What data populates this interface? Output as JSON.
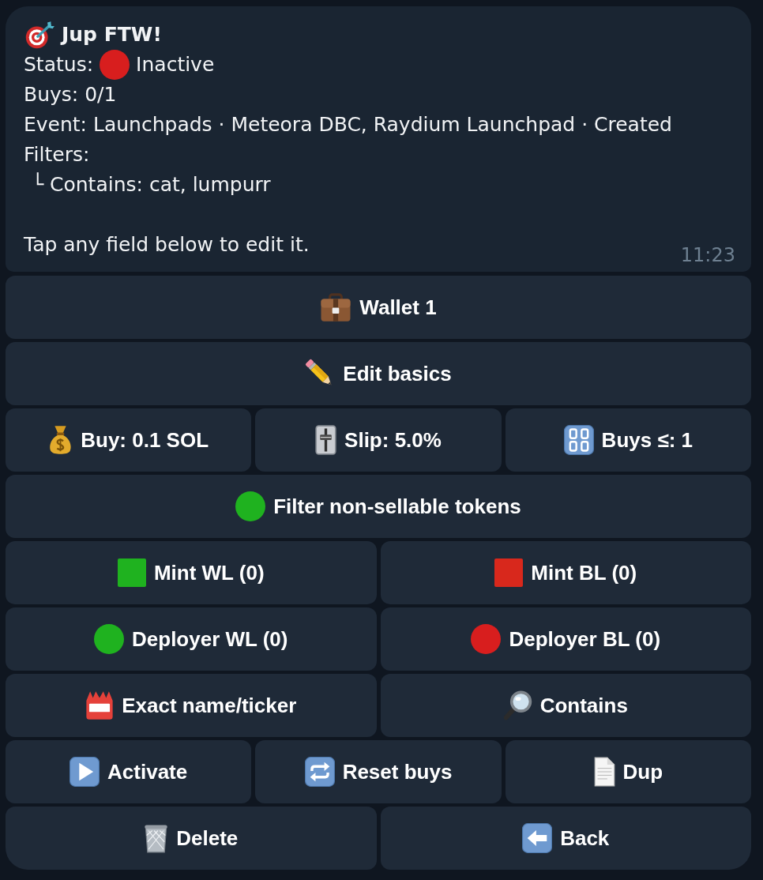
{
  "message": {
    "title": "Jup FTW!",
    "status": {
      "label": "Status:",
      "value": "Inactive",
      "active": false
    },
    "lines": [
      "Buys: 0/1",
      "Event: Launchpads · Meteora DBC, Raydium Launchpad · Created"
    ],
    "filters": {
      "label": "Filters:",
      "children": [
        {
          "text": "└ Contains: cat, lumpurr"
        }
      ]
    },
    "hint": "Tap any field below to edit it.",
    "time": "11:23"
  },
  "keyboard": {
    "rows": [
      {
        "buttons": [
          {
            "kind": "wallet",
            "label": "Wallet 1"
          }
        ]
      },
      {
        "buttons": [
          {
            "kind": "edit",
            "label": "Edit basics"
          }
        ]
      },
      {
        "buttons": [
          {
            "kind": "amount",
            "label": "Buy: 0.1 SOL"
          },
          {
            "kind": "slippage",
            "label": "Slip: 5.0%"
          },
          {
            "kind": "limit",
            "label": "Buys ≤: 1"
          }
        ]
      },
      {
        "buttons": [
          {
            "kind": "toggle",
            "label": "Filter non-sellable tokens",
            "on": true
          }
        ]
      },
      {
        "buttons": [
          {
            "kind": "mint",
            "label": "Mint WL (0)",
            "color": "#1fb21f"
          },
          {
            "kind": "mint",
            "label": "Mint BL (0)",
            "color": "#d8281c"
          }
        ]
      },
      {
        "buttons": [
          {
            "kind": "deployer",
            "label": "Deployer WL (0)",
            "color": "#1fb21f"
          },
          {
            "kind": "deployer",
            "label": "Deployer BL (0)",
            "color": "#d81e1e"
          }
        ]
      },
      {
        "buttons": [
          {
            "kind": "exact",
            "label": "Exact name/ticker"
          },
          {
            "kind": "contains",
            "label": "Contains"
          }
        ]
      },
      {
        "buttons": [
          {
            "kind": "activate",
            "label": "Activate"
          },
          {
            "kind": "reset",
            "label": "Reset buys"
          },
          {
            "kind": "duplicate",
            "label": "Dup"
          }
        ]
      },
      {
        "buttons": [
          {
            "kind": "delete",
            "label": "Delete"
          },
          {
            "kind": "back",
            "label": "Back"
          }
        ]
      }
    ]
  }
}
